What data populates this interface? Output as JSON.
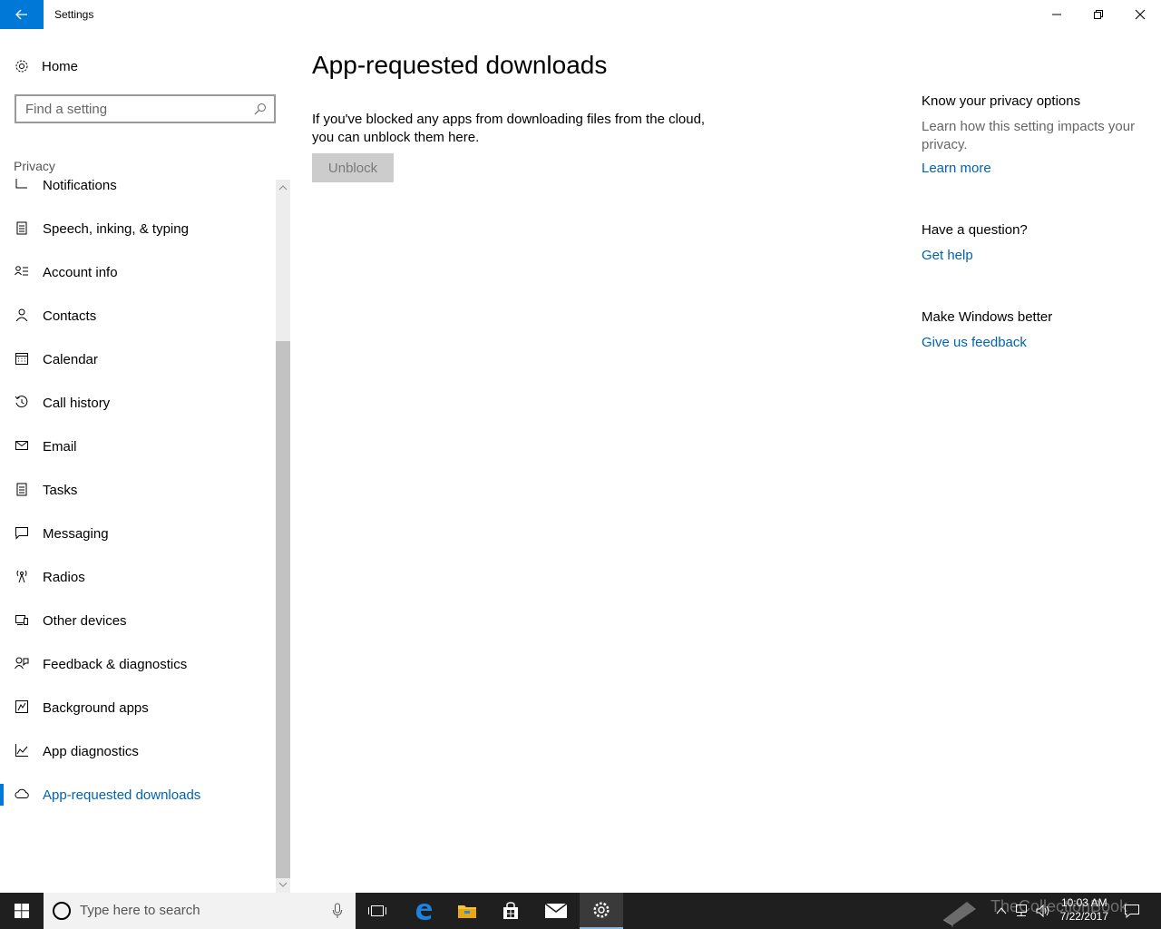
{
  "window": {
    "title": "Settings"
  },
  "sidebar": {
    "home_label": "Home",
    "search_placeholder": "Find a setting",
    "section_label": "Privacy",
    "items": [
      {
        "label": "Notifications",
        "icon": "notifications-icon"
      },
      {
        "label": "Speech, inking, & typing",
        "icon": "clipboard-icon"
      },
      {
        "label": "Account info",
        "icon": "account-info-icon"
      },
      {
        "label": "Contacts",
        "icon": "contacts-icon"
      },
      {
        "label": "Calendar",
        "icon": "calendar-icon"
      },
      {
        "label": "Call history",
        "icon": "history-icon"
      },
      {
        "label": "Email",
        "icon": "mail-icon"
      },
      {
        "label": "Tasks",
        "icon": "tasks-icon"
      },
      {
        "label": "Messaging",
        "icon": "message-icon"
      },
      {
        "label": "Radios",
        "icon": "radio-tower-icon"
      },
      {
        "label": "Other devices",
        "icon": "devices-icon"
      },
      {
        "label": "Feedback & diagnostics",
        "icon": "feedback-icon"
      },
      {
        "label": "Background apps",
        "icon": "background-apps-icon"
      },
      {
        "label": "App diagnostics",
        "icon": "chart-icon"
      },
      {
        "label": "App-requested downloads",
        "icon": "cloud-icon",
        "active": true
      }
    ]
  },
  "main": {
    "title": "App-requested downloads",
    "description_line1": "If you've blocked any apps from downloading files from the cloud,",
    "description_line2": "you can unblock them here.",
    "unblock_label": "Unblock"
  },
  "right_panel": {
    "privacy_heading": "Know your privacy options",
    "privacy_text": "Learn how this setting impacts your privacy.",
    "learn_more": "Learn more",
    "question_heading": "Have a question?",
    "get_help": "Get help",
    "better_heading": "Make Windows better",
    "feedback_link": "Give us feedback"
  },
  "taskbar": {
    "search_placeholder": "Type here to search",
    "time": "10:03 AM",
    "date": "7/22/2017",
    "watermark": "TheCollectionBook"
  },
  "colors": {
    "accent": "#0078d7",
    "link": "#0063b1",
    "taskbar": "#1f1f1f"
  }
}
